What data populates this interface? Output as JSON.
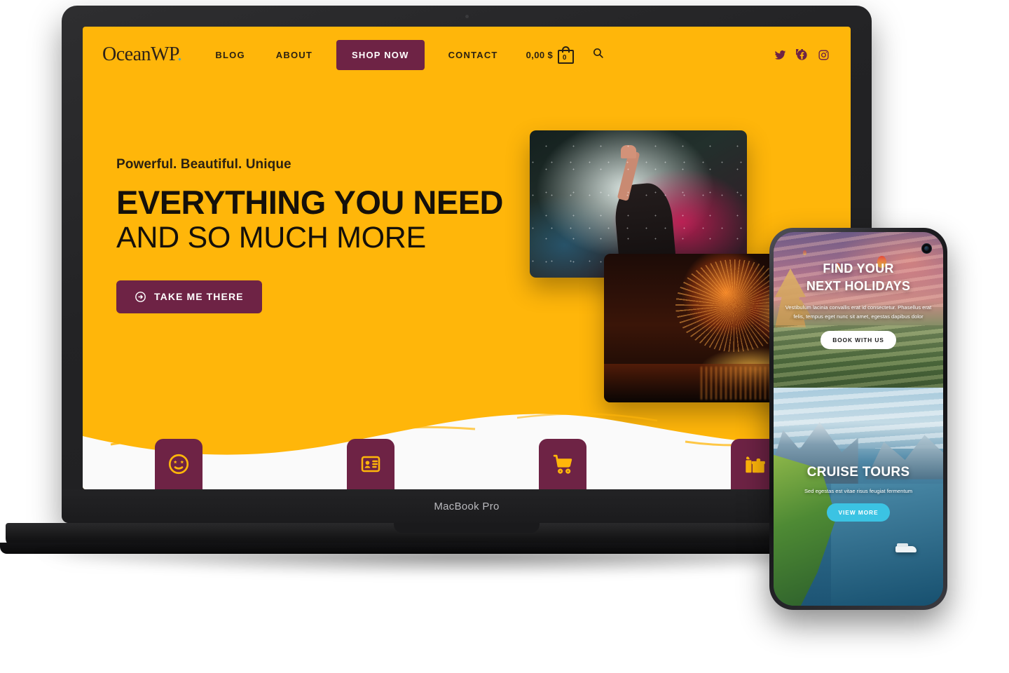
{
  "laptop": {
    "model_label": "MacBook Pro"
  },
  "site": {
    "brand": {
      "name": "OceanWP",
      "dot": "."
    },
    "nav": [
      {
        "label": "BLOG",
        "name": "nav-blog"
      },
      {
        "label": "ABOUT",
        "name": "nav-about"
      }
    ],
    "shop_now": "SHOP NOW",
    "contact": "CONTACT",
    "cart": {
      "price": "0,00 $",
      "count": "0"
    },
    "search_icon": "search-icon",
    "socials": [
      {
        "name": "twitter-icon"
      },
      {
        "name": "facebook-icon"
      },
      {
        "name": "instagram-icon"
      }
    ],
    "hero": {
      "eyebrow": "Powerful. Beautiful. Unique",
      "headline": "EVERYTHING YOU NEED",
      "subheadline": "AND SO MUCH MORE",
      "cta_label": "TAKE ME THERE",
      "cta_icon": "arrow-circle-right-icon"
    },
    "photos": [
      {
        "name": "photo-smoke-concert",
        "alt": "person raising hand in colored smoke"
      },
      {
        "name": "photo-fireworks",
        "alt": "fireworks over water at night"
      }
    ],
    "features": [
      {
        "name": "feature-card-smiley",
        "icon": "star-struck-smiley-icon"
      },
      {
        "name": "feature-card-id",
        "icon": "id-card-icon"
      },
      {
        "name": "feature-card-cart",
        "icon": "shopping-cart-icon"
      },
      {
        "name": "feature-card-gift",
        "icon": "gift-icon"
      }
    ]
  },
  "phone": {
    "camera_icon": "punch-hole-camera-icon",
    "top": {
      "title_line1": "FIND YOUR",
      "title_line2": "NEXT HOLIDAYS",
      "body": "Vestibulum lacinia convallis erat id consectetur. Phasellus erat felis, tempus eget nunc sit amet, egestas dapibus dolor",
      "cta_label": "BOOK WITH US"
    },
    "bottom": {
      "title": "CRUISE TOURS",
      "body": "Sed egestas est vitae risus feugiat fermentum",
      "cta_label": "VIEW MORE"
    }
  },
  "colors": {
    "brand_yellow": "#FFB60A",
    "maroon": "#6E2345",
    "cyan": "#3BC3E3",
    "dark_text": "#15100A",
    "white": "#FFFFFF"
  }
}
